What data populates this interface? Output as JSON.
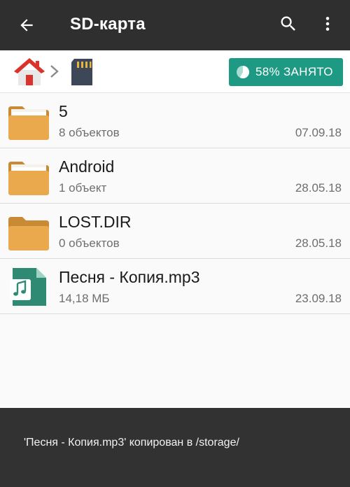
{
  "appbar": {
    "title": "SD-карта",
    "back_icon": "arrow-back-icon",
    "search_icon": "search-icon",
    "more_icon": "more-vert-icon"
  },
  "breadcrumb": {
    "items": [
      {
        "icon": "home-icon"
      },
      {
        "icon": "sd-card-icon"
      }
    ],
    "separator_icon": "chevron-right-icon"
  },
  "storage": {
    "usage_label": "58% ЗАНЯТО",
    "usage_fraction": 0.58,
    "badge_color": "#1e9a84"
  },
  "files": [
    {
      "name": "5",
      "meta": "8 объектов",
      "date": "07.09.18",
      "type": "folder"
    },
    {
      "name": "Android",
      "meta": "1 объект",
      "date": "28.05.18",
      "type": "folder"
    },
    {
      "name": "LOST.DIR",
      "meta": "0 объектов",
      "date": "28.05.18",
      "type": "folder-empty"
    },
    {
      "name": "Песня - Копия.mp3",
      "meta": "14,18 МБ",
      "date": "23.09.18",
      "type": "audio"
    }
  ],
  "snackbar": {
    "message": "'Песня - Копия.mp3' копирован в /storage/"
  },
  "colors": {
    "appbar": "#2f2f2f",
    "accent": "#1e9a84",
    "folder": "#e9a84c",
    "audio": "#2f8a74"
  }
}
